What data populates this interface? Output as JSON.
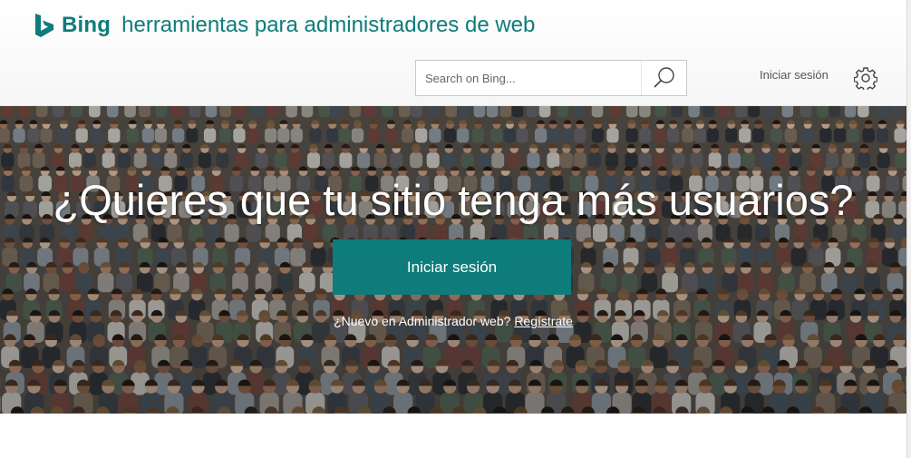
{
  "header": {
    "brand": "Bing",
    "product": "herramientas para administradores de web",
    "search_placeholder": "Search on Bing...",
    "signin_link": "Iniciar sesión",
    "icons": {
      "logo": "bing-logo-icon",
      "search": "search-icon",
      "settings": "gear-icon"
    }
  },
  "hero": {
    "title": "¿Quieres que tu sitio tenga más usuarios?",
    "signin_button": "Iniciar sesión",
    "register_prompt": "¿Nuevo en Administrador web?",
    "register_link": "Regístrate"
  },
  "colors": {
    "accent": "#0e7c7b",
    "hero_fallback": "#5b544c"
  }
}
